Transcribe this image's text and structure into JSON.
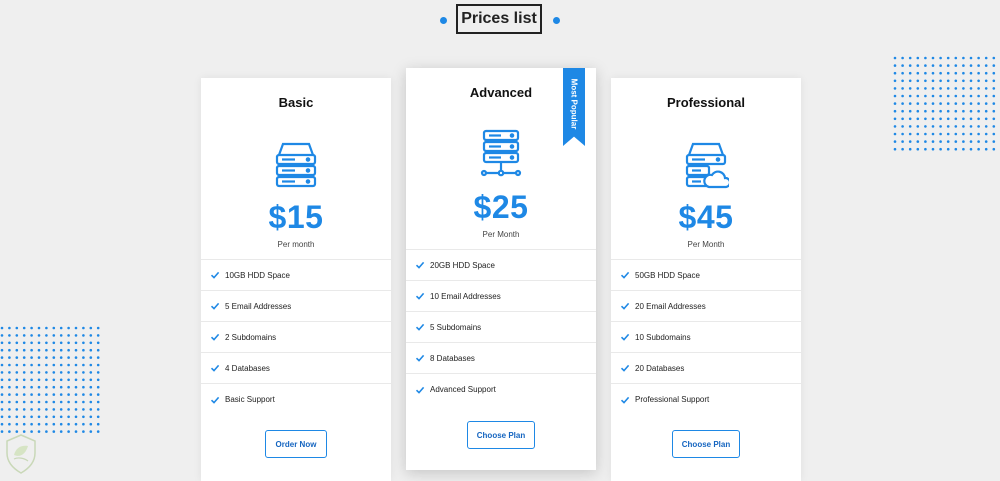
{
  "page": {
    "title": "Prices list"
  },
  "colors": {
    "accent": "#1e88e5",
    "background": "#efefef",
    "card": "#ffffff"
  },
  "plans": [
    {
      "name": "Basic",
      "icon": "server-stack-icon",
      "price": "$15",
      "period": "Per month",
      "features": [
        "10GB HDD Space",
        "5 Email Addresses",
        "2 Subdomains",
        "4 Databases",
        "Basic Support"
      ],
      "cta": "Order Now"
    },
    {
      "name": "Advanced",
      "icon": "server-network-icon",
      "price": "$25",
      "period": "Per Month",
      "badge": "Most Popular",
      "features": [
        "20GB HDD Space",
        "10 Email Addresses",
        "5 Subdomains",
        "8 Databases",
        "Advanced Support"
      ],
      "cta": "Choose Plan"
    },
    {
      "name": "Professional",
      "icon": "server-cloud-icon",
      "price": "$45",
      "period": "Per Month",
      "features": [
        "50GB HDD Space",
        "20 Email Addresses",
        "10 Subdomains",
        "20 Databases",
        "Professional Support"
      ],
      "cta": "Choose Plan"
    }
  ]
}
